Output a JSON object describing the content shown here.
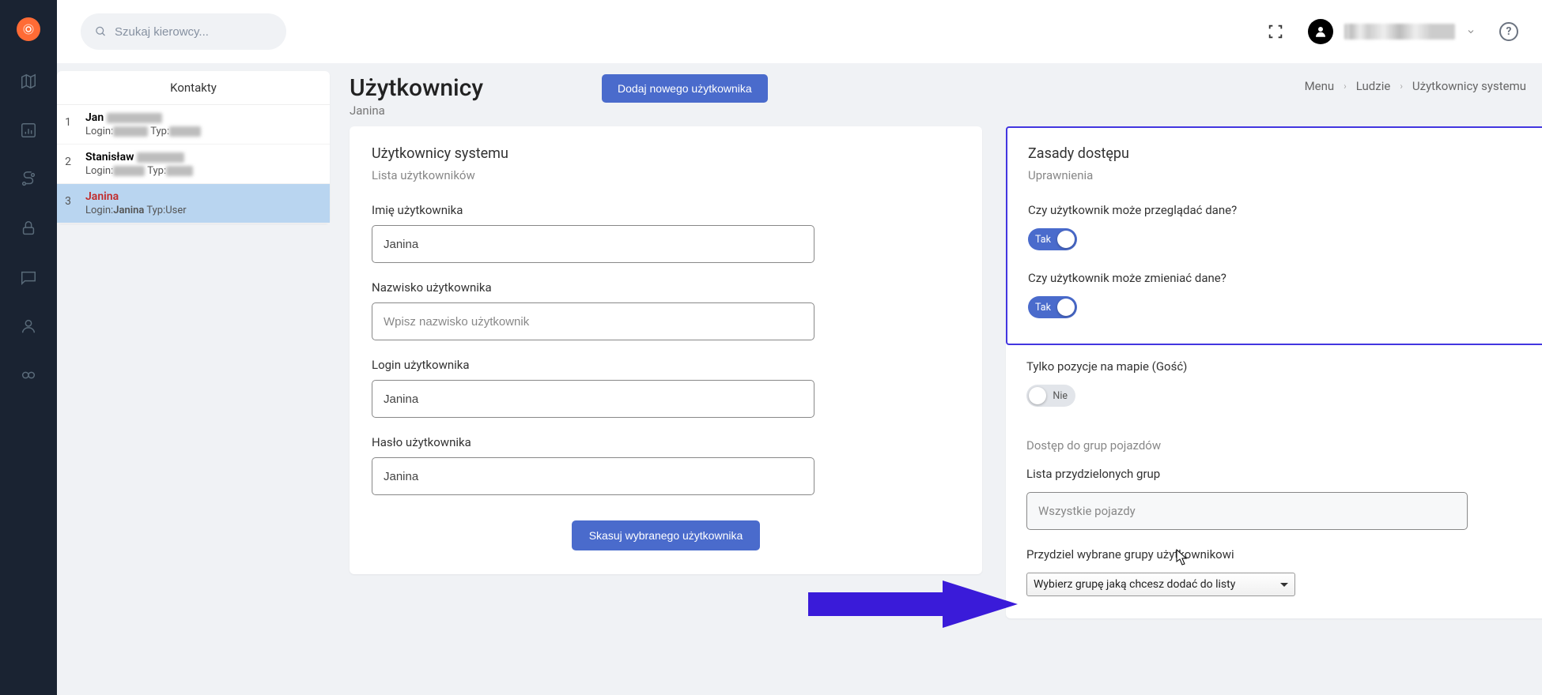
{
  "header": {
    "search_placeholder": "Szukaj kierowcy...",
    "help_label": "?"
  },
  "contacts": {
    "header": "Kontakty",
    "rows": [
      {
        "idx": "1",
        "name": "Jan",
        "login_label": "Login:",
        "typ_label": "Typ:"
      },
      {
        "idx": "2",
        "name": "Stanisław",
        "login_label": "Login:",
        "typ_label": "Typ:"
      },
      {
        "idx": "3",
        "name": "Janina",
        "login_label": "Login:",
        "login_val": "Janina",
        "typ_label": "Typ:",
        "typ_val": "User"
      }
    ]
  },
  "page": {
    "title": "Użytkownicy",
    "subtitle": "Janina",
    "add_button": "Dodaj nowego użytkownika",
    "breadcrumb": [
      "Menu",
      "Ludzie",
      "Użytkownicy systemu"
    ]
  },
  "form": {
    "card_title": "Użytkownicy systemu",
    "card_subtitle": "Lista użytkowników",
    "first_name_label": "Imię użytkownika",
    "first_name_value": "Janina",
    "last_name_label": "Nazwisko użytkownika",
    "last_name_placeholder": "Wpisz nazwisko użytkownik",
    "login_label": "Login użytkownika",
    "login_value": "Janina",
    "password_label": "Hasło użytkownika",
    "password_value": "Janina",
    "delete_button": "Skasuj wybranego użytkownika"
  },
  "access": {
    "title": "Zasady dostępu",
    "subtitle": "Uprawnienia",
    "can_view_label": "Czy użytkownik może przeglądać dane?",
    "can_edit_label": "Czy użytkownik może zmieniać dane?",
    "toggle_yes": "Tak",
    "toggle_no": "Nie",
    "map_only_label": "Tylko pozycje na mapie (Gość)",
    "group_access_label": "Dostęp do grup pojazdów",
    "assigned_groups_label": "Lista przydzielonych grup",
    "assigned_groups_value": "Wszystkie pojazdy",
    "assign_select_label": "Przydziel wybrane grupy użytkownikowi",
    "assign_select_value": "Wybierz grupę jaką chcesz dodać do listy"
  }
}
